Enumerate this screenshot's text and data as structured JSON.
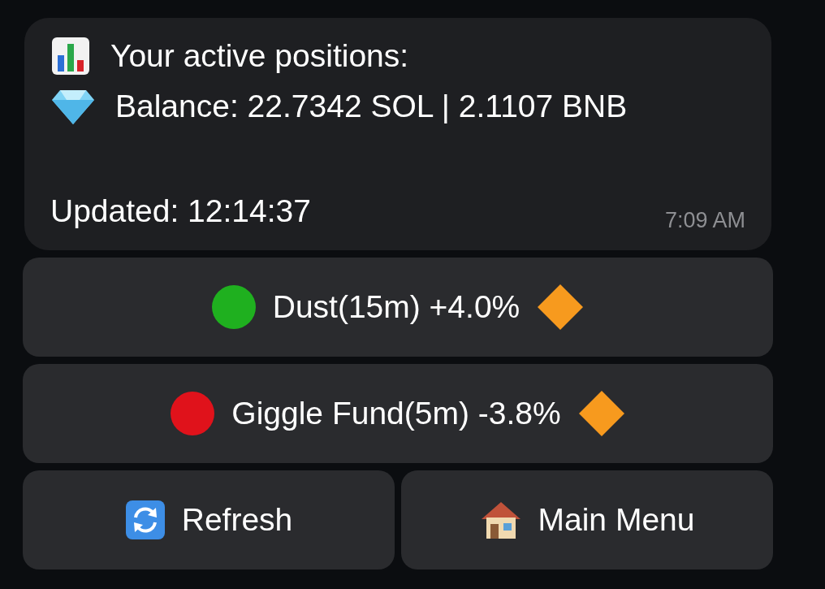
{
  "message": {
    "lines": [
      {
        "kind": "chart",
        "text": "Your active positions:"
      },
      {
        "kind": "gem",
        "text": "Balance: 22.7342 SOL | 2.1107 BNB"
      },
      {
        "kind": "plain",
        "text": "Updated: 12:14:37"
      }
    ],
    "time": "7:09 AM"
  },
  "keyboard": [
    [
      {
        "kind": "position",
        "label": "Dust(15m) +4.0%",
        "color": "#1fb01f"
      }
    ],
    [
      {
        "kind": "position",
        "label": "Giggle Fund(5m) -3.8%",
        "color": "#e0121b"
      }
    ],
    [
      {
        "kind": "refresh",
        "label": "Refresh"
      },
      {
        "kind": "home",
        "label": "Main Menu"
      }
    ]
  ]
}
